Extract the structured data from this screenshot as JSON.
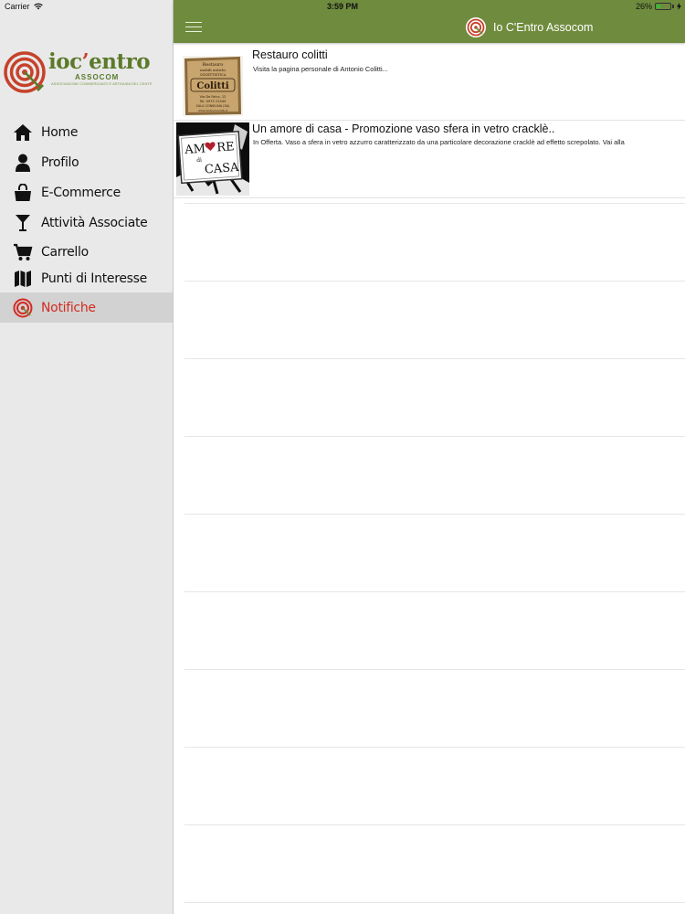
{
  "status_bar": {
    "carrier": "Carrier",
    "time": "3:59 PM",
    "battery": "26%",
    "battery_level": 0.26
  },
  "sidebar": {
    "brand": {
      "name_main": "ioc",
      "name_apostrophe": "’",
      "name_rest": "entro",
      "sub": "ASSOCOM",
      "tagline": "ASSOCIAZIONE COMMERCIANTI E ARTIGIANI DEL CENTRO DI SALA CONSILINA"
    },
    "items": [
      {
        "label": "Home",
        "icon": "home-icon"
      },
      {
        "label": "Profilo",
        "icon": "user-icon"
      },
      {
        "label": "E-Commerce",
        "icon": "shopping-bag-icon"
      },
      {
        "label": "Attività Associate",
        "icon": "cocktail-glass-icon"
      },
      {
        "label": "Carrello",
        "icon": "cart-icon"
      },
      {
        "label": "Punti di Interesse",
        "icon": "map-icon"
      },
      {
        "label": "Notifiche",
        "icon": "target-icon",
        "active": true
      }
    ]
  },
  "navbar": {
    "title": "Io C'Entro Assocom",
    "menu_icon": "hamburger-icon"
  },
  "notifications": [
    {
      "title": "Restauro colitti",
      "description": "Visita la pagina personale di Antonio Colitti...",
      "thumb": {
        "lines": [
          "Restauro",
          "mobili antichi",
          "OGGETTISTICA",
          "Colitti",
          "Via De Falco, 12",
          "Tel. 0975 21440",
          "SALA CONSILINA (SA)",
          "www.restaurocolitti.it"
        ]
      }
    },
    {
      "title": "Un amore di casa - Promozione vaso sfera in vetro cracklè..",
      "description": "In Offerta. Vaso a sfera in vetro azzurro caratterizzato da una particolare decorazione cracklè ad effetto screpolato. Vai alla",
      "thumb": {
        "line1": "AM",
        "line1_rest": "RE",
        "line2": "di",
        "line3": "CASA"
      }
    }
  ],
  "colors": {
    "navbar": "#6f8c3e",
    "sidebar_bg": "#e9e9ea",
    "active_item_bg": "#d2d2d3",
    "active_item_text": "#d32b21",
    "brand_green": "#5b7a2a",
    "brand_red": "#c6422a"
  }
}
